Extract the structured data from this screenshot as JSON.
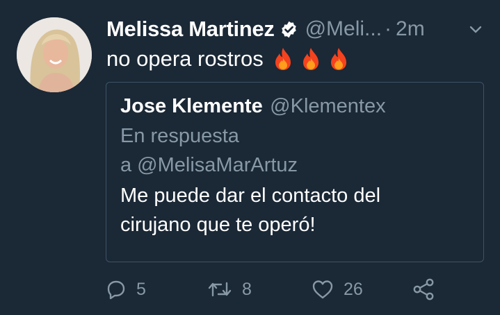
{
  "tweet": {
    "author_name": "Melissa Martinez",
    "author_handle": "@Meli...",
    "separator": "·",
    "time": "2m",
    "text": "no opera rostros",
    "emoji": [
      "fire",
      "fire",
      "fire"
    ]
  },
  "quoted": {
    "author_name": "Jose Klemente",
    "author_handle": "@Klementex",
    "reply_line1": "En respuesta",
    "reply_line2": "a @MelisaMarArtuz",
    "text_line1": "Me puede dar el contacto del",
    "text_line2": "cirujano que te operó!"
  },
  "actions": {
    "reply_count": "5",
    "retweet_count": "8",
    "like_count": "26"
  },
  "colors": {
    "background": "#1b2836",
    "muted": "#8899a6",
    "border": "#3d5466",
    "text": "#ffffff"
  }
}
